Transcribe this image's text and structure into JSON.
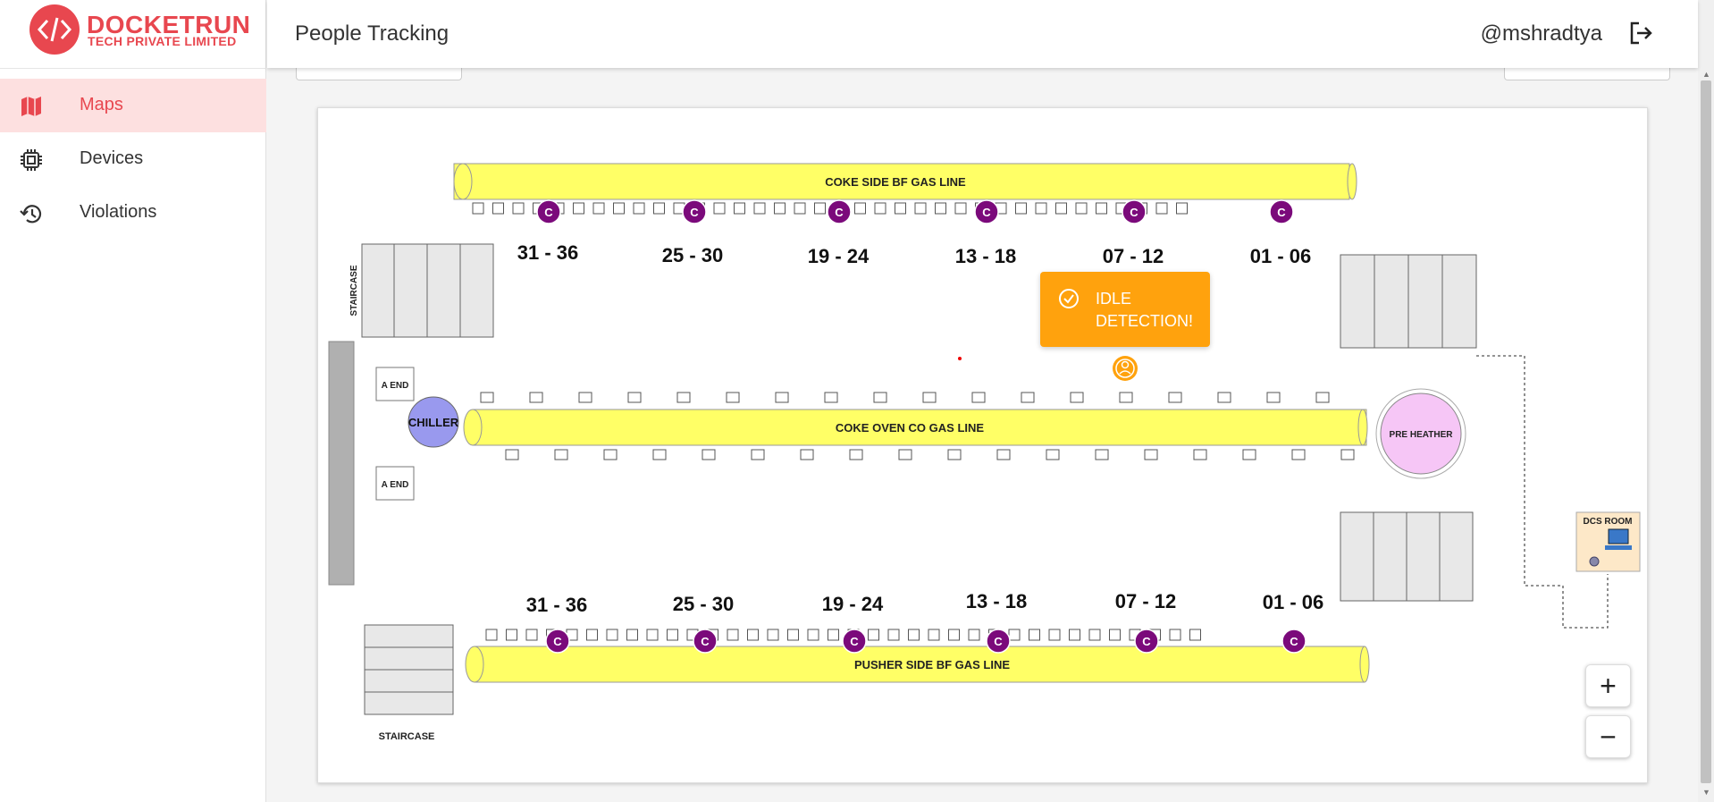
{
  "brand": {
    "name": "DOCKETRUN",
    "subtitle": "TECH PRIVATE LIMITED",
    "logo_icon": "code-brackets-icon",
    "color": "#e8474f"
  },
  "nav": [
    {
      "label": "Maps",
      "icon": "map-icon",
      "active": true
    },
    {
      "label": "Devices",
      "icon": "chip-icon",
      "active": false
    },
    {
      "label": "Violations",
      "icon": "history-icon",
      "active": false
    }
  ],
  "header": {
    "title": "People Tracking",
    "username": "@mshradtya",
    "logout_icon": "logout-icon"
  },
  "map": {
    "pipes": {
      "top": "COKE SIDE BF GAS LINE",
      "middle": "COKE OVEN CO GAS LINE",
      "bottom": "PUSHER SIDE BF GAS LINE"
    },
    "top_ranges": [
      "31 - 36",
      "25 - 30",
      "19 - 24",
      "13 - 18",
      "07 - 12",
      "01 - 06"
    ],
    "bottom_ranges": [
      "31 - 36",
      "25 - 30",
      "19 - 24",
      "13 - 18",
      "07 - 12",
      "01 - 06"
    ],
    "marker_letter": "C",
    "staircase_top": "STAIRCASE",
    "staircase_bottom": "STAIRCASE",
    "a_end_top": "A END",
    "a_end_bottom": "A END",
    "chiller": "CHILLER",
    "pre_heater": "PRE HEATHER",
    "dcs_room": "DCS ROOM",
    "colors": {
      "pipe": "#ffff66",
      "marker": "#7b0a7b",
      "chiller": "#9999ee",
      "preheater": "#f6c6f6",
      "person": "#ffa20d"
    }
  },
  "toast": {
    "line1": "IDLE",
    "line2": "DETECTION!",
    "icon": "check-circle-icon",
    "color": "#ffa20d"
  },
  "zoom": {
    "in": "+",
    "out": "−"
  }
}
